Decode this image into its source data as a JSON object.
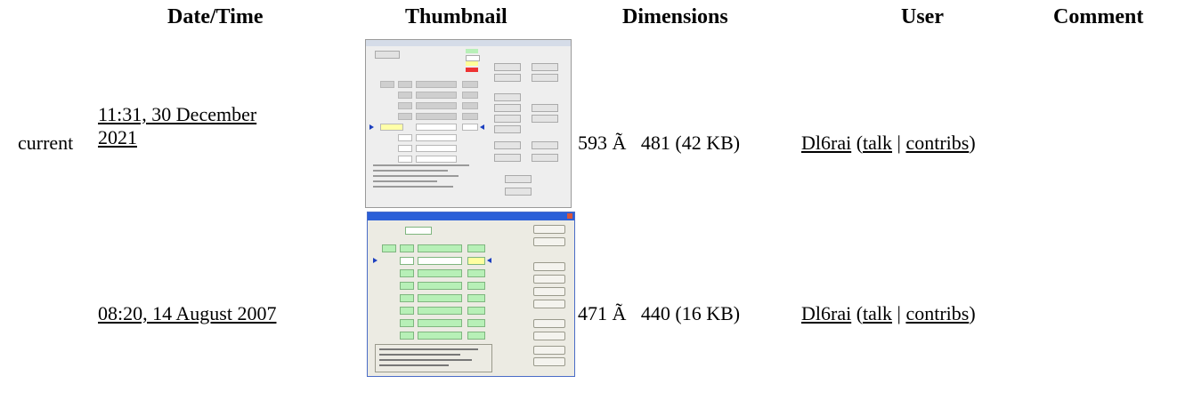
{
  "headers": {
    "datetime": "Date/Time",
    "thumbnail": "Thumbnail",
    "dimensions": "Dimensions",
    "user": "User",
    "comment": "Comment"
  },
  "rows": [
    {
      "status": "current",
      "datetime_line1": "11:31, 30 December",
      "datetime_line2": "2021",
      "dimensions": "593 Ã   481 (42 KB)",
      "user": "Dl6rai",
      "talk": "talk",
      "contribs": "contribs"
    },
    {
      "status": "",
      "datetime": "08:20, 14 August 2007",
      "dimensions": "471 Ã   440 (16 KB)",
      "user": "Dl6rai",
      "talk": "talk",
      "contribs": "contribs"
    }
  ],
  "punct": {
    "open": " (",
    "sep": " | ",
    "close": ")"
  }
}
